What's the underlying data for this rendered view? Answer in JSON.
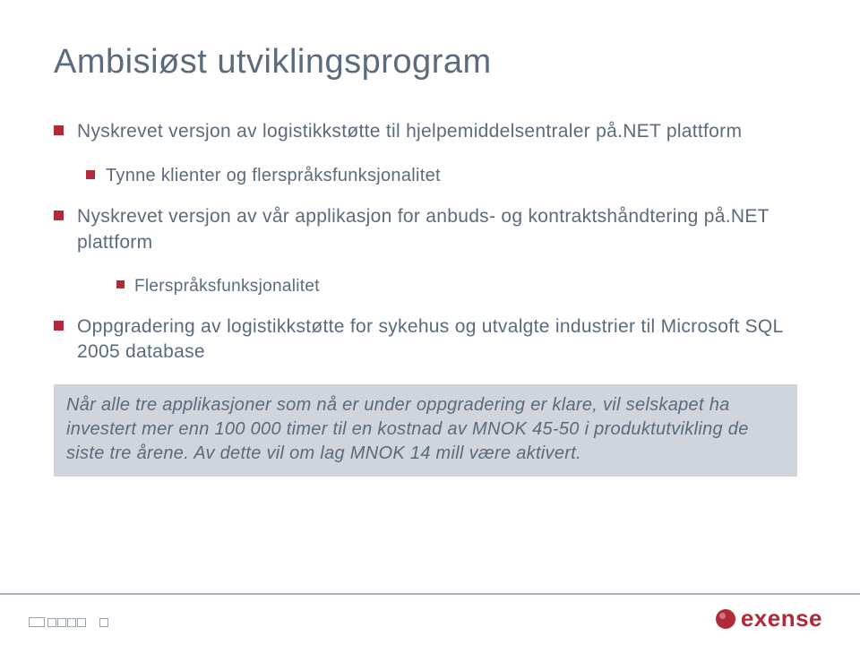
{
  "title": "Ambisiøst utviklingsprogram",
  "bullets": {
    "b1a": "Nyskrevet versjon av logistikkstøtte til hjelpemiddelsentraler på.NET plattform",
    "b2a": "Tynne klienter og flerspråksfunksjonalitet",
    "b1b": "Nyskrevet versjon av vår applikasjon for anbuds- og kontraktshåndtering på.NET plattform",
    "b3a": "Flerspråksfunksjonalitet",
    "b1c": "Oppgradering av logistikkstøtte for sykehus og utvalgte industrier til Microsoft SQL 2005 database"
  },
  "callout": "Når alle tre applikasjoner som nå er under oppgradering er klare, vil selskapet ha investert mer enn 100 000 timer til en kostnad av MNOK 45-50 i produktutvikling de siste tre årene. Av dette vil om lag MNOK 14 mill være aktivert.",
  "logo": "exense"
}
